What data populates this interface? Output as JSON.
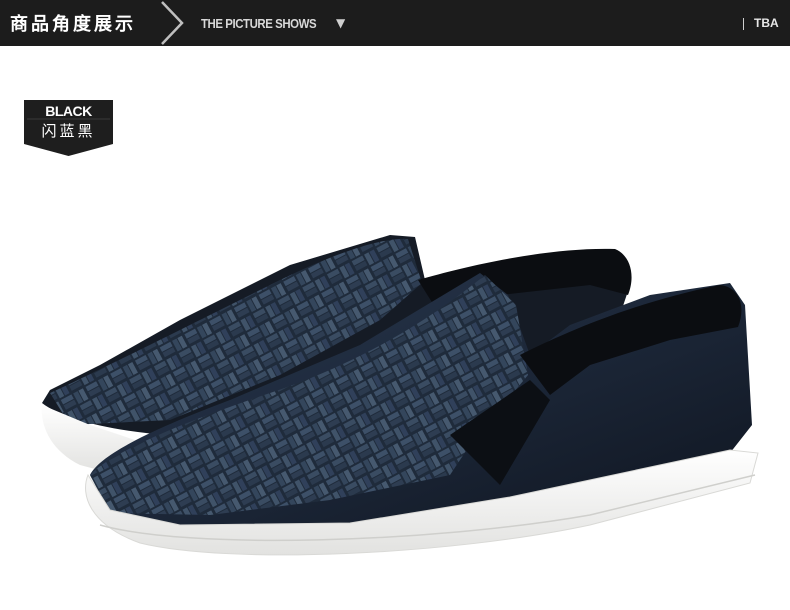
{
  "header": {
    "title": "商品角度展示",
    "subtitle": "THE PICTURE SHOWS",
    "arrow": "▼",
    "right_label": "TBA"
  },
  "color_tag": {
    "english": "BLACK",
    "chinese": "闪蓝黑"
  },
  "product": {
    "name": "woven-slip-on-shoes",
    "upper_color": "#1a2433",
    "sole_color": "#f4f4f2"
  },
  "colors": {
    "header_bg": "#1c1c1c",
    "header_text": "#ffffff",
    "tag_bg": "#1e1e1e"
  }
}
